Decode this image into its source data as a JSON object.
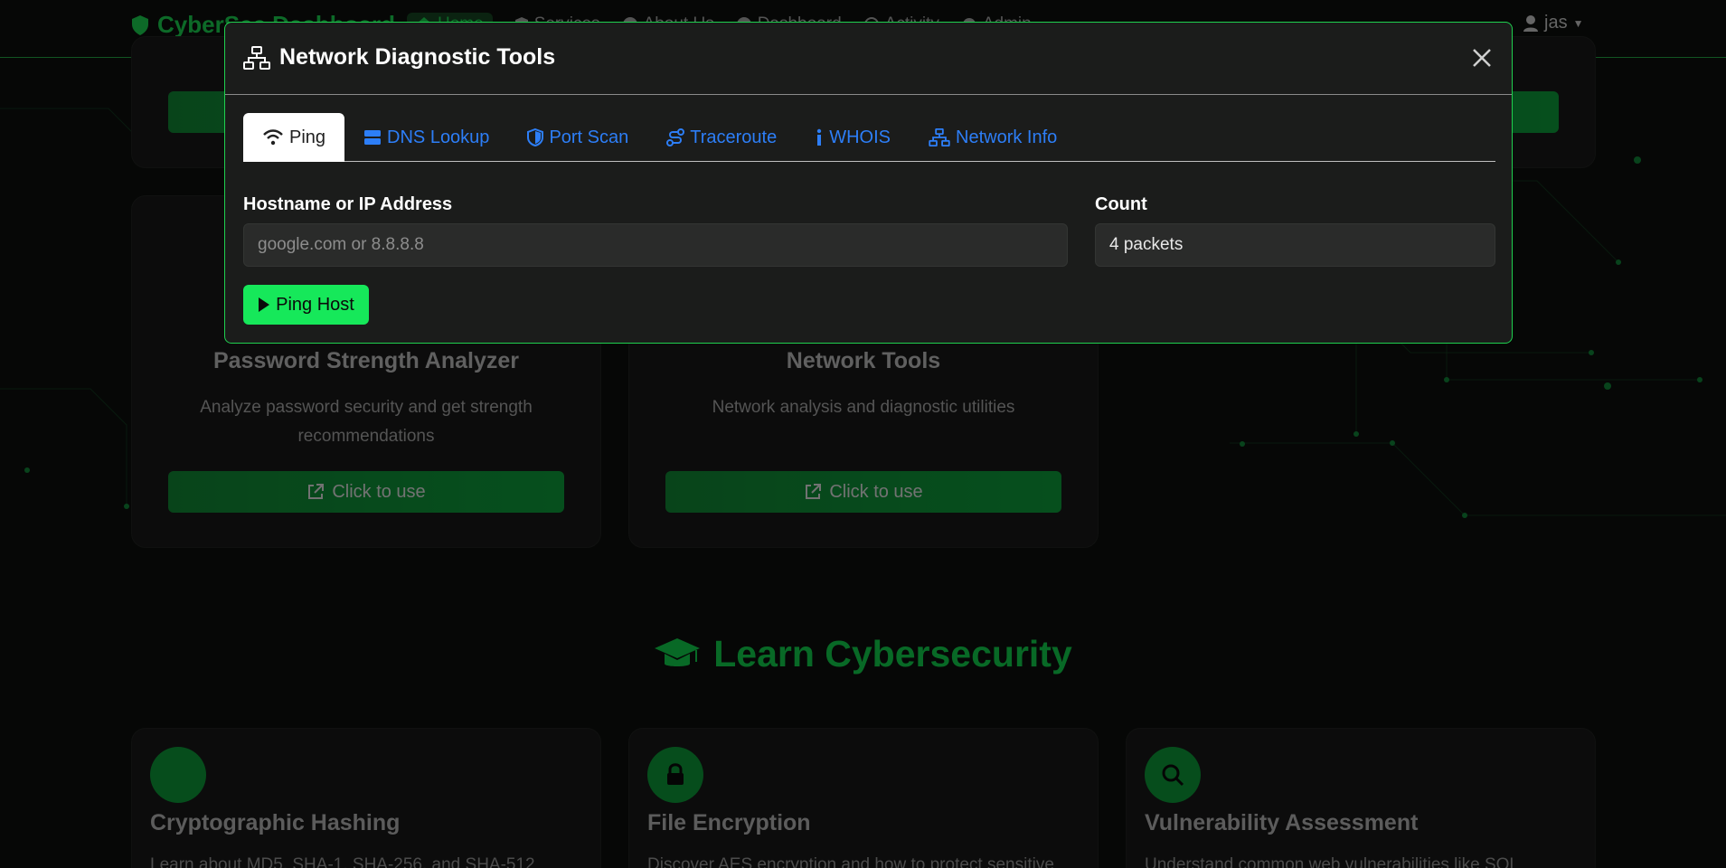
{
  "navbar": {
    "brand": "CyberSec Dashboard",
    "links": [
      {
        "label": "Home"
      },
      {
        "label": "Services"
      },
      {
        "label": "About Us"
      },
      {
        "label": "Dashboard"
      },
      {
        "label": "Activity"
      },
      {
        "label": "Admin"
      }
    ],
    "user": "jas"
  },
  "cards": [
    {
      "title": "Password Strength Analyzer",
      "desc": "Analyze password security and get strength recommendations",
      "button": "Click to use"
    },
    {
      "title": "Network Tools",
      "desc": "Network analysis and diagnostic utilities",
      "button": "Click to use"
    }
  ],
  "learn": {
    "title": "Learn Cybersecurity",
    "cards": [
      {
        "title": "Cryptographic Hashing",
        "desc": "Learn about MD5, SHA-1, SHA-256, and SHA-512"
      },
      {
        "title": "File Encryption",
        "desc": "Discover AES encryption and how to protect sensitive"
      },
      {
        "title": "Vulnerability Assessment",
        "desc": "Understand common web vulnerabilities like SQL"
      }
    ]
  },
  "modal": {
    "title": "Network Diagnostic Tools",
    "tabs": [
      {
        "label": "Ping"
      },
      {
        "label": "DNS Lookup"
      },
      {
        "label": "Port Scan"
      },
      {
        "label": "Traceroute"
      },
      {
        "label": "WHOIS"
      },
      {
        "label": "Network Info"
      }
    ],
    "host_label": "Hostname or IP Address",
    "host_placeholder": "google.com or 8.8.8.8",
    "host_value": "",
    "count_label": "Count",
    "count_value": "4 packets",
    "submit_label": "Ping Host"
  },
  "colors": {
    "accent": "#18c24a",
    "link": "#2d7ef7",
    "modal_border": "#1fd04f"
  }
}
